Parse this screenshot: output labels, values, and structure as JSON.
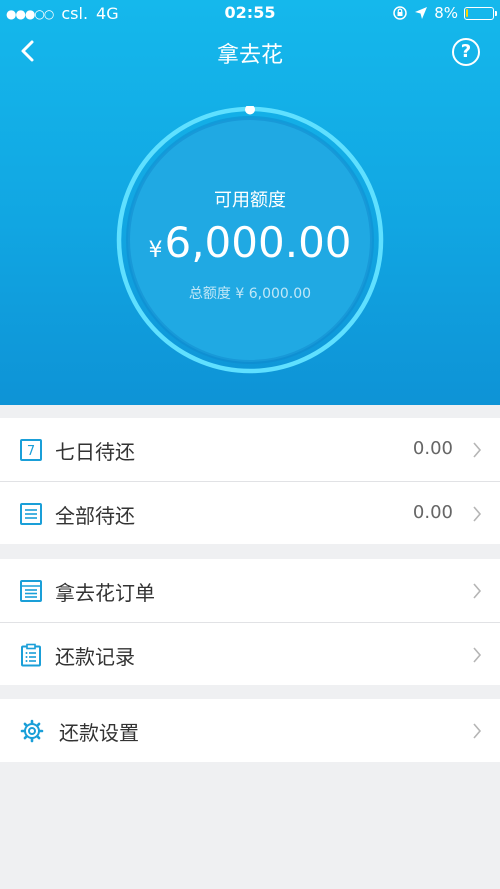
{
  "status_bar": {
    "signal": "●●●○○",
    "carrier": "csl.",
    "network": "4G",
    "time": "02:55",
    "battery": "8%",
    "battery_level": 0.08
  },
  "nav": {
    "title": "拿去花",
    "back_icon": "chevron-left-icon",
    "help_icon": "question-circle-icon",
    "help_glyph": "?"
  },
  "credit": {
    "available_label": "可用额度",
    "currency": "¥",
    "available_amount": "6,000.00",
    "total_label": "总额度 ¥ 6,000.00"
  },
  "groups": [
    {
      "items": [
        {
          "label": "七日待还",
          "value": "0.00",
          "icon": "calendar-7-icon",
          "icon_text": "7"
        },
        {
          "label": "全部待还",
          "value": "0.00",
          "icon": "bill-list-icon"
        }
      ]
    },
    {
      "items": [
        {
          "label": "拿去花订单",
          "icon": "order-list-icon"
        },
        {
          "label": "还款记录",
          "icon": "clipboard-record-icon"
        }
      ]
    },
    {
      "items": [
        {
          "label": "还款设置",
          "icon": "gear-icon"
        }
      ]
    }
  ],
  "colors": {
    "hero_top": "#15b8ec",
    "hero_bottom": "#0e93d6",
    "ring": "#5fe0ff",
    "icon": "#1a9fd8",
    "page_bg": "#eff0f2"
  }
}
